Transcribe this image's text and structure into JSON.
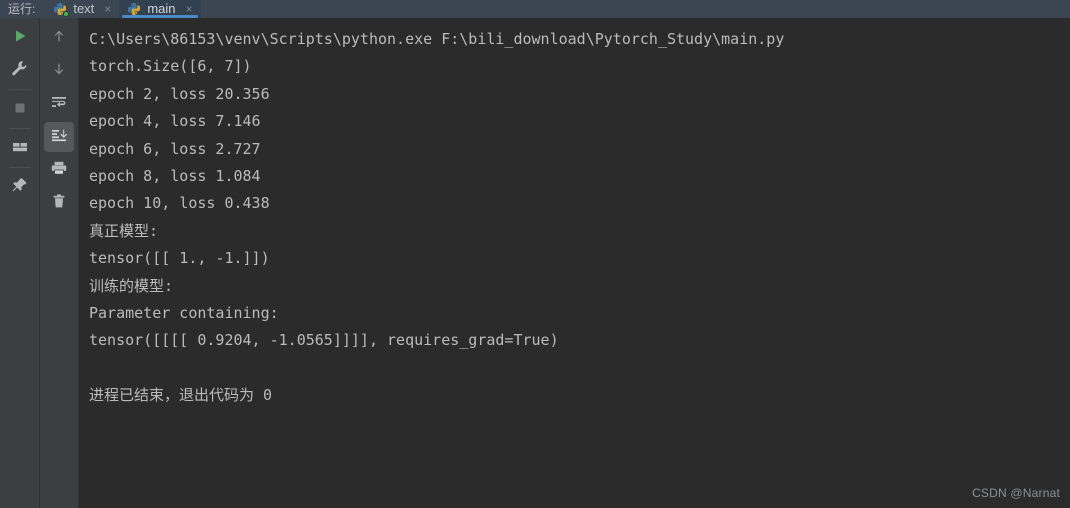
{
  "window": {
    "run_label": "运行:",
    "console_bg": "#2b2b2b",
    "tabbar_bg": "#3c4653",
    "toolbar_bg": "#3c3f41",
    "accent_blue": "#4a88c7",
    "run_green": "#49b34a",
    "console_text_color": "#bbbbbb"
  },
  "tabs": [
    {
      "label": "text",
      "icon": "python-file-icon",
      "active": false,
      "running_indicator": true,
      "close_label": "×"
    },
    {
      "label": "main",
      "icon": "python-file-icon",
      "active": true,
      "running_indicator": false,
      "close_label": "×"
    }
  ],
  "toolbar_primary": [
    {
      "name": "rerun-button",
      "icon": "play-icon",
      "selected": false
    },
    {
      "name": "settings-button",
      "icon": "wrench-icon",
      "selected": false
    },
    {
      "name": "separator-1",
      "icon": "separator",
      "selected": false
    },
    {
      "name": "stop-button",
      "icon": "stop-square-icon",
      "selected": false
    },
    {
      "name": "separator-2",
      "icon": "separator",
      "selected": false
    },
    {
      "name": "layout-button",
      "icon": "panels-icon",
      "selected": false
    },
    {
      "name": "separator-3",
      "icon": "separator",
      "selected": false
    },
    {
      "name": "pin-tab-button",
      "icon": "pin-icon",
      "selected": false
    }
  ],
  "toolbar_secondary": [
    {
      "name": "up-button",
      "icon": "arrow-up-icon",
      "selected": false
    },
    {
      "name": "down-button",
      "icon": "arrow-down-icon",
      "selected": false
    },
    {
      "name": "soft-wrap-button",
      "icon": "soft-wrap-icon",
      "selected": false
    },
    {
      "name": "scroll-to-end-button",
      "icon": "scroll-to-end-icon",
      "selected": true
    },
    {
      "name": "print-button",
      "icon": "printer-icon",
      "selected": false
    },
    {
      "name": "clear-all-button",
      "icon": "trash-icon",
      "selected": false
    }
  ],
  "console": {
    "lines": [
      "C:\\Users\\86153\\venv\\Scripts\\python.exe F:\\bili_download\\Pytorch_Study\\main.py",
      "torch.Size([6, 7])",
      "epoch 2, loss 20.356",
      "epoch 4, loss 7.146",
      "epoch 6, loss 2.727",
      "epoch 8, loss 1.084",
      "epoch 10, loss 0.438",
      "真正模型:",
      "tensor([[ 1., -1.]])",
      "训练的模型:",
      "Parameter containing:",
      "tensor([[[[ 0.9204, -1.0565]]]], requires_grad=True)",
      "",
      "进程已结束，退出代码为 0"
    ]
  },
  "watermark": {
    "text": "CSDN @Narnat"
  }
}
